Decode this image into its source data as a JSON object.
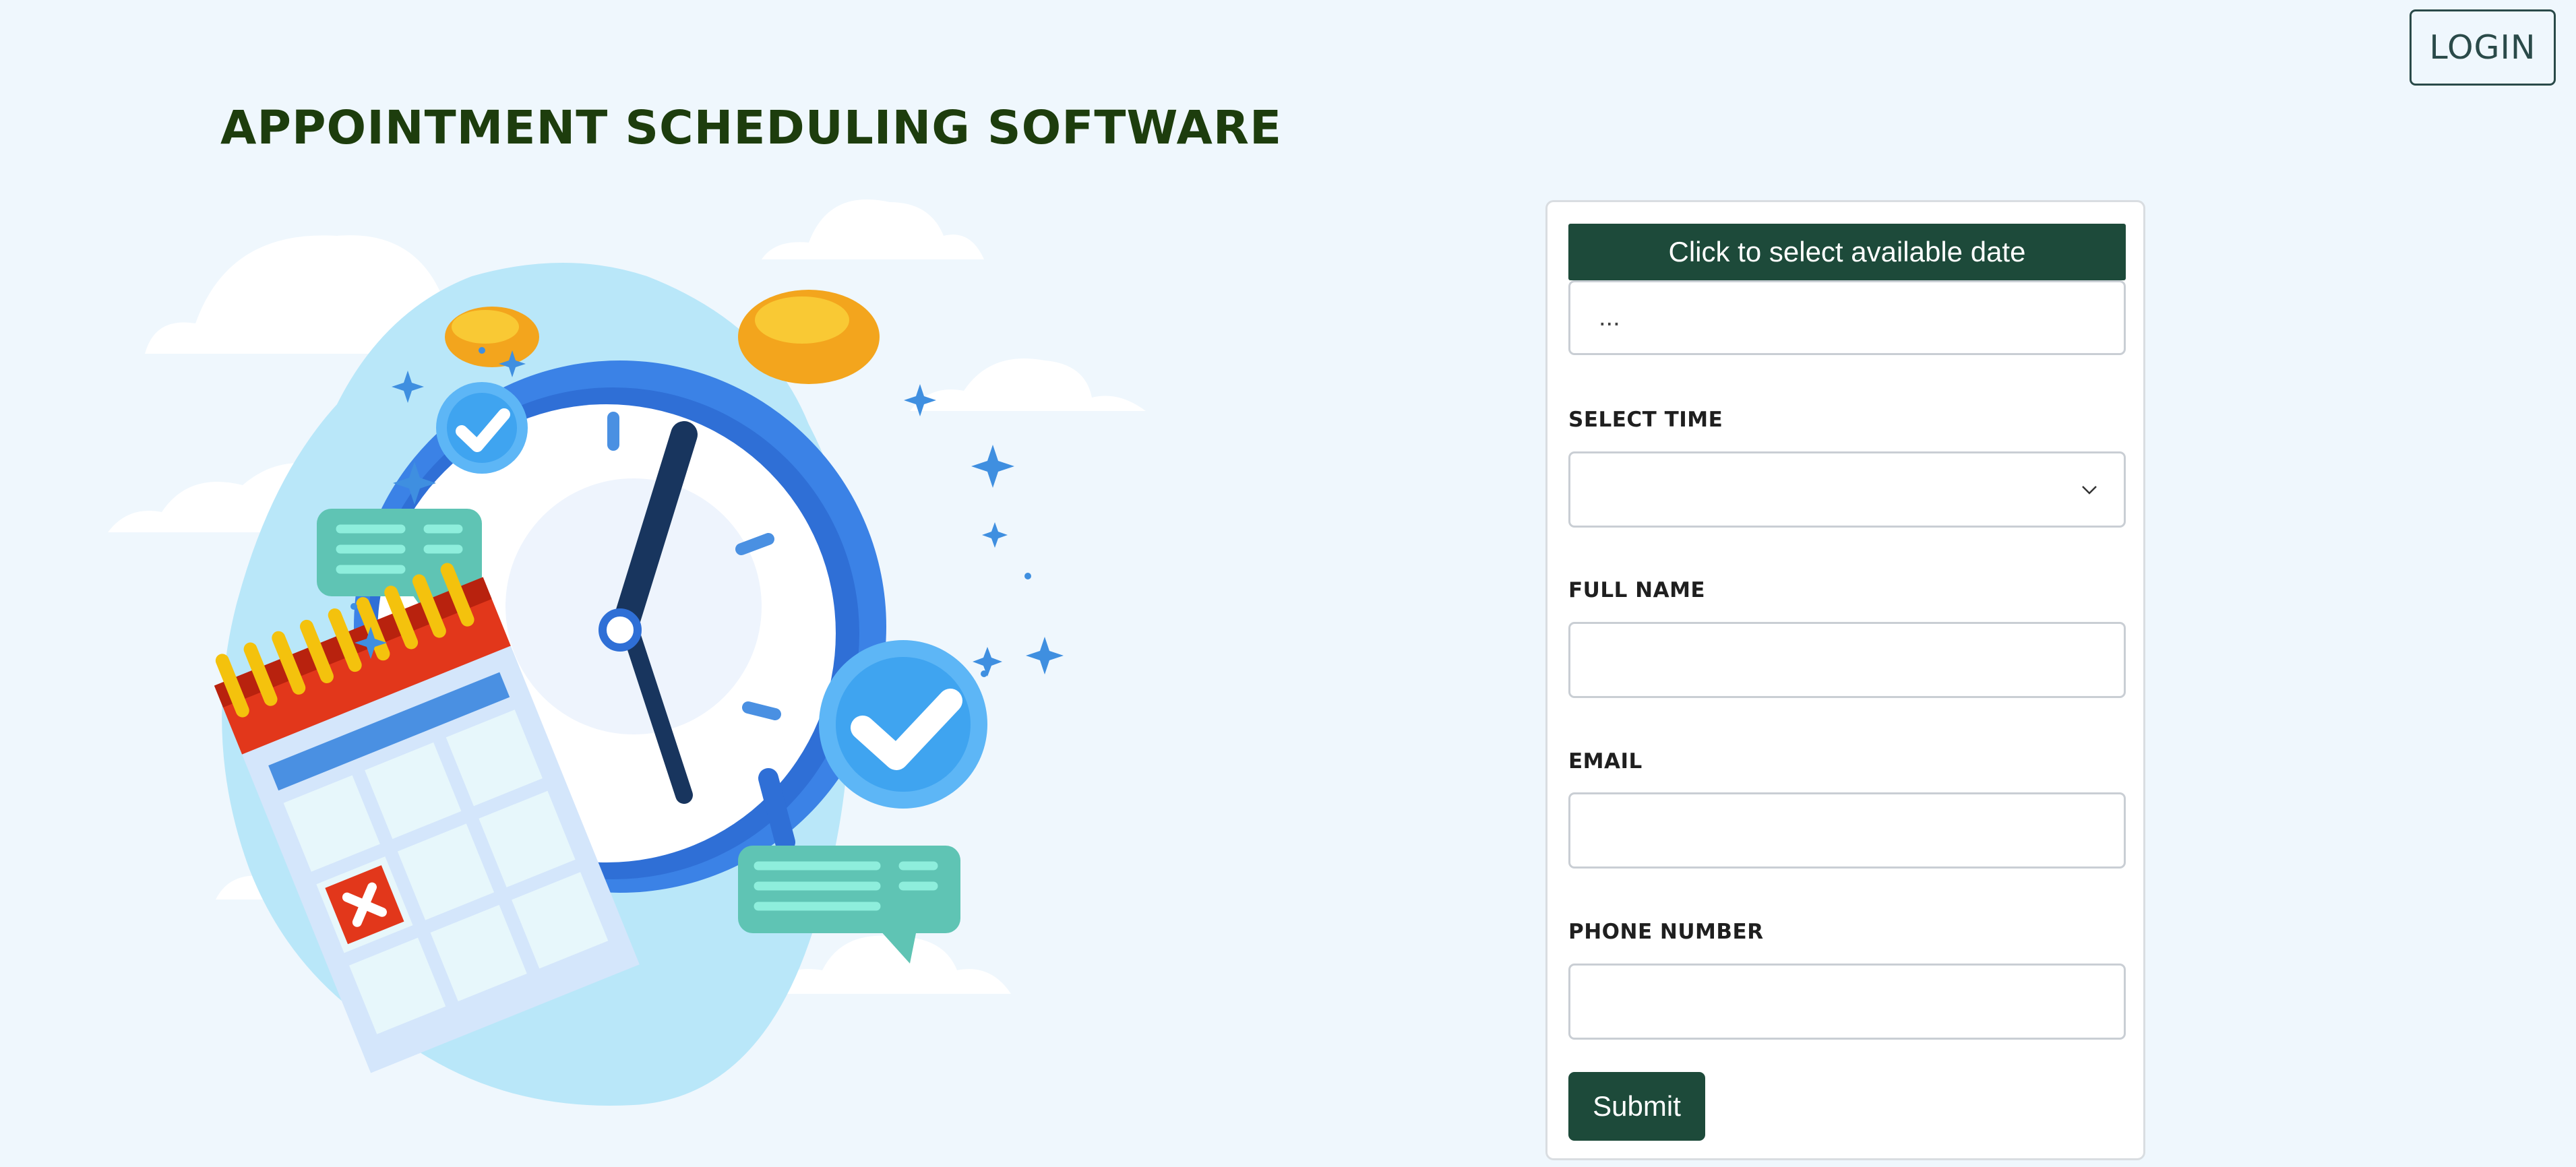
{
  "header": {
    "login_label": "LOGIN"
  },
  "page": {
    "title": "APPOINTMENT SCHEDULING SOFTWARE"
  },
  "form": {
    "date_button_label": "Click to select available date",
    "date_value": "...",
    "time_label": "SELECT TIME",
    "time_value": "",
    "name_label": "FULL NAME",
    "email_label": "EMAIL",
    "phone_label": "PHONE NUMBER",
    "submit_label": "Submit"
  },
  "colors": {
    "page_background": "#eff7fd",
    "title": "#1d3d0d",
    "primary_button": "#1d4a3a",
    "login_border": "#2a4a49"
  },
  "icons": [
    "chevron-down-icon",
    "clock-icon",
    "calendar-icon",
    "check-icon",
    "chat-bubble-icon",
    "cancel-icon"
  ]
}
